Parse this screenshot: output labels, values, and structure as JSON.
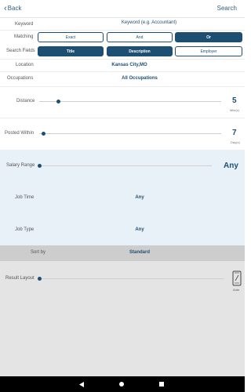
{
  "header": {
    "back_label": "Back",
    "search_label": "Search"
  },
  "keyword": {
    "label": "Keyword",
    "placeholder": "Keyword (e.g. Accountant)"
  },
  "matching": {
    "label": "Matching",
    "options": [
      "Exact",
      "And",
      "Or"
    ],
    "selected": "Or"
  },
  "search_fields": {
    "label": "Search Fields",
    "options": [
      "Title",
      "Description",
      "Employer"
    ],
    "selected": [
      "Title",
      "Description"
    ]
  },
  "location": {
    "label": "Location",
    "value": "Kansas City,MO"
  },
  "occupations": {
    "label": "Occupations",
    "value": "All Occupations"
  },
  "distance": {
    "label": "Distance",
    "value": "5",
    "unit": "Mile(s)",
    "slider_level": 0.08
  },
  "posted_within": {
    "label": "Posted Within",
    "value": "7",
    "unit": "Day(s)",
    "slider_level": 0.0
  },
  "salary_range": {
    "label": "Salary Range",
    "value": "Any",
    "slider_level": 0.0
  },
  "job_time": {
    "label": "Job Time",
    "value": "Any"
  },
  "job_type": {
    "label": "Job Type",
    "value": "Any"
  },
  "sort_by": {
    "label": "Sort by",
    "value": "Standard"
  },
  "result_layout": {
    "label": "Result Layout",
    "value": "Auto",
    "slider_level": 0.0
  },
  "colors": {
    "primary": "#1d4f73",
    "band_blue": "#e8f1f8",
    "band_gray": "#e4e4e4"
  },
  "icons": [
    "chevron-left-icon",
    "phone-layout-icon",
    "nav-back-icon",
    "nav-home-icon",
    "nav-recents-icon"
  ]
}
